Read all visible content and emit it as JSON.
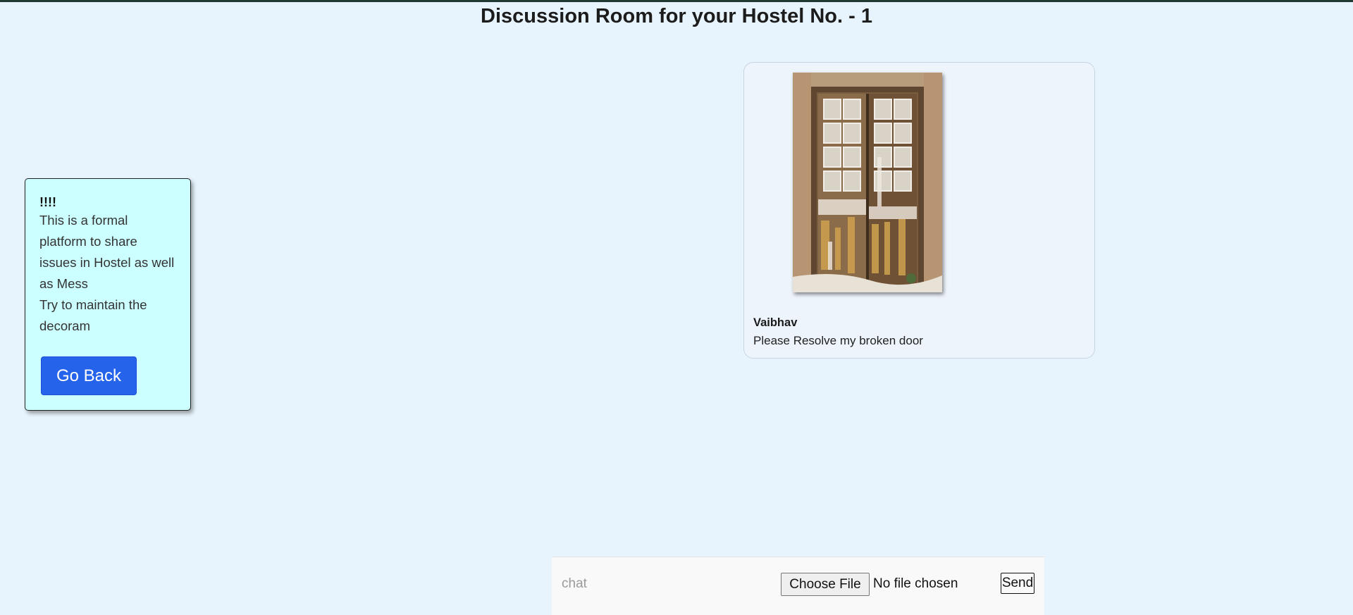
{
  "page": {
    "title": "Discussion Room for your Hostel No. - 1"
  },
  "info_card": {
    "heading": "!!!!",
    "lines": [
      "This is a formal platform to share issues in Hostel as well as Mess",
      "Try to maintain the decoram"
    ],
    "go_back_label": "Go Back"
  },
  "messages": [
    {
      "author": "Vaibhav",
      "text": "Please Resolve my broken door",
      "image": "broken-door-photo"
    }
  ],
  "chat_bar": {
    "input_placeholder": "chat",
    "input_value": "",
    "choose_file_label": "Choose File",
    "file_status": "No file chosen",
    "send_label": "Send"
  }
}
